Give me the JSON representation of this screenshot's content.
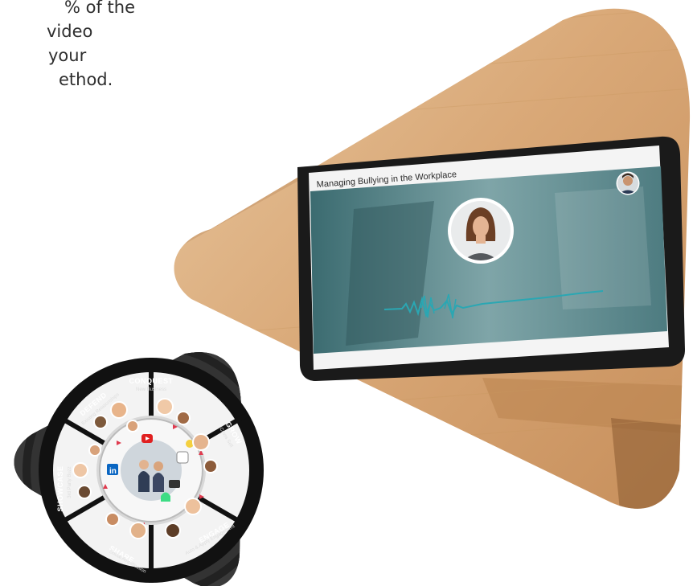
{
  "intro_text": {
    "line1": "% of the",
    "line2": "video",
    "line3": "your",
    "line4": "ethod."
  },
  "tablet": {
    "video_title": "Managing Bullying in the Workplace",
    "presenter_icon": "presenter-avatar-icon",
    "host_icon": "host-avatar-icon",
    "waveform_color": "#2aa7b3"
  },
  "wheel": {
    "segments": [
      {
        "label": "CONQUEST",
        "sub": "New Business"
      },
      {
        "label": "GROW",
        "sub": "Cross Sell"
      },
      {
        "label": "ENGAGE",
        "sub": "Auto & Apply Engagement"
      },
      {
        "label": "SHARE",
        "sub": "Social Amplification"
      },
      {
        "label": "SHOWCASE",
        "sub": "3rd Party Buzz"
      },
      {
        "label": "DEFEND",
        "sub": "Existing Relationships"
      }
    ],
    "center_icon": "team-icon",
    "hub_icons": [
      "linkedin-icon",
      "youtube-icon",
      "slack-icon",
      "camera-icon",
      "android-icon",
      "lightbulb-icon"
    ],
    "accent": "#e03a4e"
  }
}
